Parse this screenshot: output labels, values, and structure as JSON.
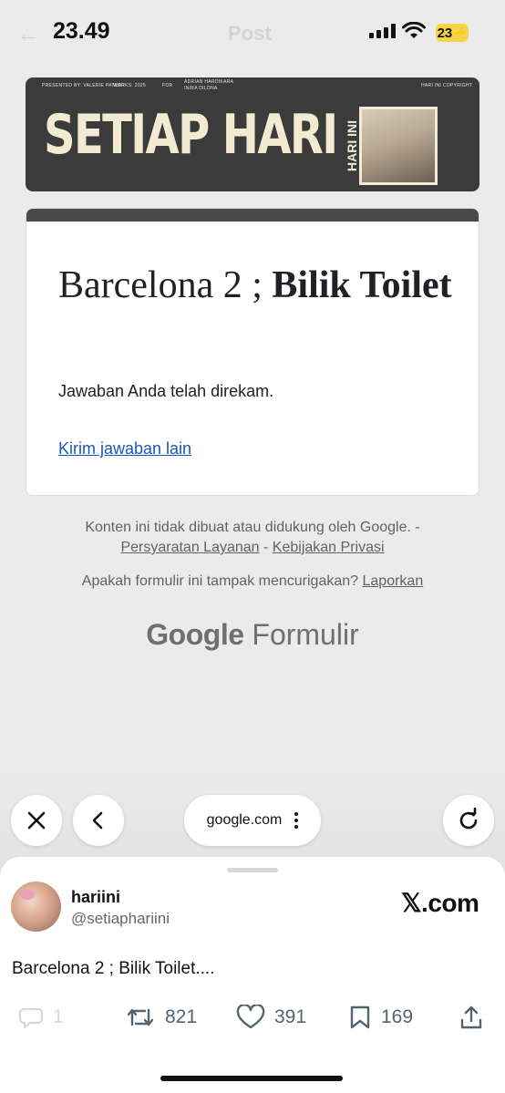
{
  "status_bar": {
    "time": "23.49",
    "battery": "23",
    "background_page_title": "Post"
  },
  "banner": {
    "presented_by": "PRESENTED BY: VALERIE PATKAR",
    "works": "WORKS: 2025",
    "for_label": "FOR",
    "for_names_1": "ADRIAN HARDIKARA",
    "for_names_2": "INIRA DILONA",
    "copyright": "HARI INI COPYRIGHT",
    "title": "SETIAP HARI",
    "vertical_text": "HARI INI"
  },
  "form": {
    "title_regular": "Barcelona 2 ;  ",
    "title_bold": "Bilik Toilet",
    "confirmation": "Jawaban Anda telah direkam.",
    "submit_another": "Kirim jawaban lain"
  },
  "footer": {
    "disclaimer": "Konten ini tidak dibuat atau didukung oleh Google. -",
    "terms": "Persyaratan Layanan",
    "separator": "-",
    "privacy": "Kebijakan Privasi",
    "suspicious": "Apakah formulir ini tampak mencurigakan?",
    "report": "Laporkan",
    "logo_google": "Google",
    "logo_product": "Formulir"
  },
  "browser": {
    "url": "google.com"
  },
  "tweet": {
    "display_name": "hariini",
    "handle": "@setiaphariini",
    "site": "𝕏.com",
    "text": "Barcelona 2 ; Bilik Toilet....",
    "replies": "1",
    "retweets": "821",
    "likes": "391",
    "bookmarks": "169"
  },
  "icons": {
    "back": "chevron-left-icon",
    "close": "close-icon",
    "reload": "reload-icon",
    "reply": "comment-icon",
    "retweet": "retweet-icon",
    "like": "heart-icon",
    "bookmark": "bookmark-icon",
    "share": "share-icon"
  },
  "colors": {
    "link": "#1a56c2",
    "banner_bg": "#3b3b3b",
    "banner_text": "#f3ead2",
    "battery": "#f5d547"
  }
}
